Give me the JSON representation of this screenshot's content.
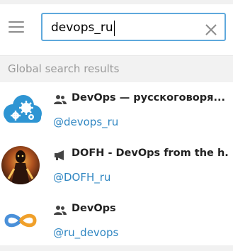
{
  "search": {
    "value": "devops_ru"
  },
  "section": {
    "title": "Global search results"
  },
  "results": [
    {
      "type": "group",
      "title": "DevOps — русскоговоря...",
      "handle": "@devops_ru"
    },
    {
      "type": "channel",
      "title": "DOFH - DevOps from the h...",
      "handle": "@DOFH_ru"
    },
    {
      "type": "group",
      "title": "DevOps",
      "handle": "@ru_devops"
    }
  ],
  "colors": {
    "accent": "#5fa9dc",
    "link": "#2f86c2",
    "section_bg": "#f2f2f2",
    "muted_text": "#9a9a9a"
  }
}
